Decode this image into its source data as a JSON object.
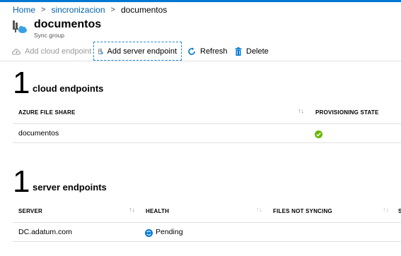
{
  "breadcrumb": {
    "items": [
      "Home",
      "sincronizacion",
      "documentos"
    ],
    "separator": ">"
  },
  "header": {
    "title": "documentos",
    "subtitle": "Sync group",
    "icon": "sync-group-icon"
  },
  "toolbar": {
    "add_cloud_endpoint": "Add cloud endpoint",
    "add_server_endpoint": "Add server endpoint",
    "refresh": "Refresh",
    "delete": "Delete"
  },
  "cloud_endpoints": {
    "count": "1",
    "title": "cloud endpoints",
    "columns": [
      "AZURE FILE SHARE",
      "PROVISIONING STATE"
    ],
    "rows": [
      {
        "share": "documentos",
        "state_icon": "success-check-icon"
      }
    ]
  },
  "server_endpoints": {
    "count": "1",
    "title": "server endpoints",
    "columns": [
      "SERVER",
      "HEALTH",
      "FILES NOT SYNCING"
    ],
    "rows": [
      {
        "server": "DC.adatum.com",
        "health": "Pending",
        "health_icon": "sync-pending-icon"
      }
    ]
  },
  "colors": {
    "accent": "#0078d4",
    "link": "#0062ad",
    "success": "#6bb700",
    "pending": "#0078d4"
  }
}
